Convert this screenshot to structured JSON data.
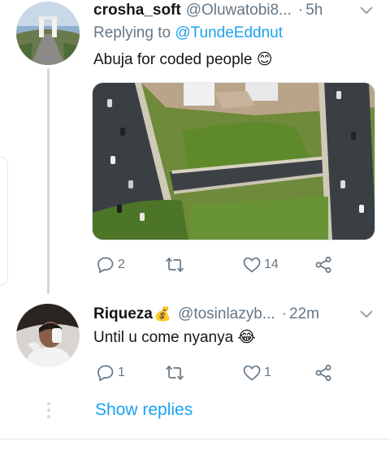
{
  "tweets": [
    {
      "name": "crosha_soft",
      "handle": "@Oluwatobi8...",
      "time": "5h",
      "replying_prefix": "Replying to",
      "replying_to": "@TundeEddnut",
      "text": "Abuja for coded people 😊",
      "replies": "2",
      "retweets": "",
      "likes": "14",
      "avatar_icon": "city-gate-photo",
      "media_icon": "highway-aerial-photo"
    },
    {
      "name": "Riqueza",
      "badge": "💰",
      "handle": "@tosinlazyb...",
      "time": "22m",
      "text": "Until u come nyanya 😂",
      "replies": "1",
      "retweets": "",
      "likes": "1",
      "avatar_icon": "person-photo"
    }
  ],
  "show_replies": "Show replies",
  "colors": {
    "accent": "#1da1f2",
    "secondary_text": "#657786",
    "thread_line": "#cfd9de"
  }
}
